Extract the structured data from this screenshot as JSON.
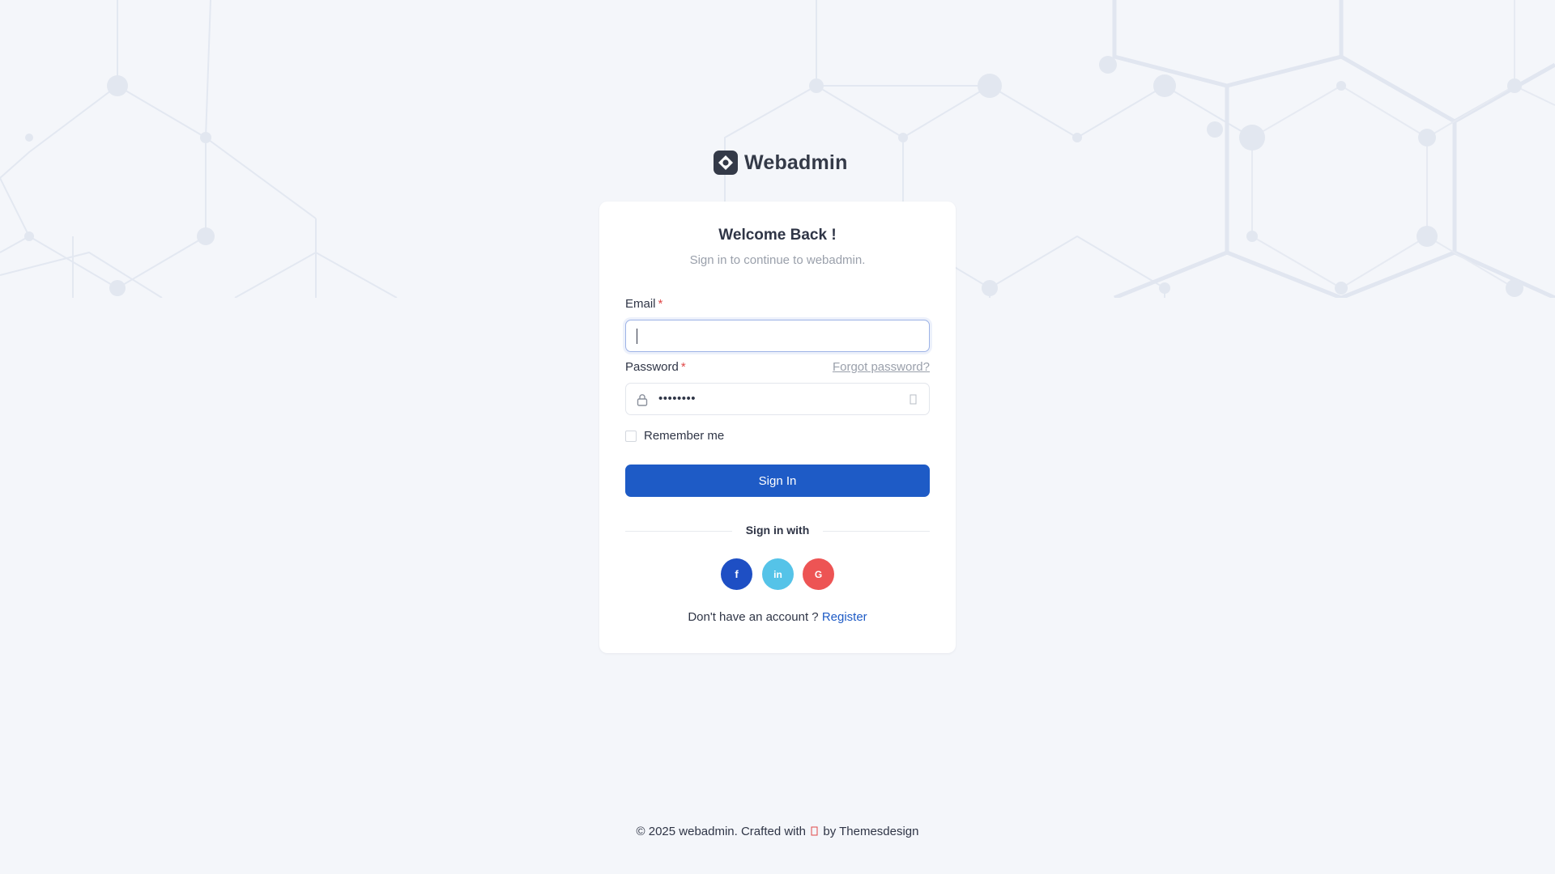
{
  "brand": {
    "name": "Webadmin",
    "logo_icon": "webadmin-logo-icon",
    "color": "#343a48"
  },
  "card": {
    "title": "Welcome Back !",
    "subtitle": "Sign in to continue to webadmin."
  },
  "form": {
    "email": {
      "label": "Email",
      "required_mark": "*",
      "value": "",
      "placeholder": ""
    },
    "password": {
      "label": "Password",
      "required_mark": "*",
      "value": "••••••••",
      "forgot_label": "Forgot password?",
      "lock_icon": "lock-icon",
      "toggle_icon": "eye-icon"
    },
    "remember_label": "Remember me",
    "remember_checked": false,
    "submit_label": "Sign In"
  },
  "social": {
    "heading": "Sign in with",
    "buttons": [
      {
        "name": "facebook",
        "glyph": "f",
        "color": "#1e4fc4"
      },
      {
        "name": "linkedin",
        "glyph": "in",
        "color": "#55c3e8"
      },
      {
        "name": "google",
        "glyph": "G",
        "color": "#ed5454"
      }
    ]
  },
  "register": {
    "prompt": "Don't have an account ?",
    "link_label": "Register"
  },
  "footer": {
    "prefix": "© 2025 webadmin. Crafted with",
    "heart_icon": "heart-icon",
    "suffix": "by Themesdesign"
  },
  "colors": {
    "primary": "#1e5bc6",
    "background": "#f4f6fa",
    "required": "#e04848"
  }
}
